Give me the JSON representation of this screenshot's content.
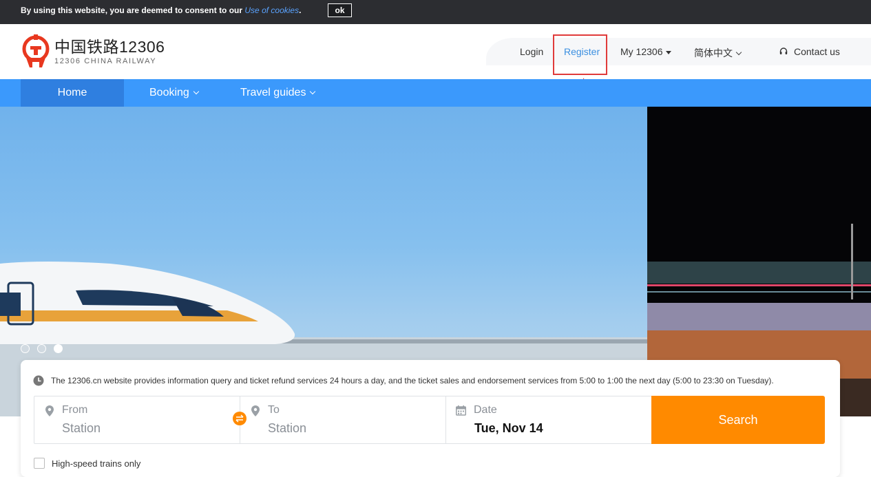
{
  "cookie": {
    "message": "By using this website, you are deemed to consent to our ",
    "link": "Use of cookies",
    "suffix": ".",
    "ok": "ok"
  },
  "logo": {
    "cn": "中国铁路12306",
    "en": "12306 CHINA RAILWAY"
  },
  "top_nav": {
    "login": "Login",
    "register": "Register",
    "my": "My 12306",
    "language": "简体中文",
    "contact": "Contact us"
  },
  "main_nav": {
    "home": "Home",
    "booking": "Booking",
    "guides": "Travel guides"
  },
  "carousel": {
    "slides": 3,
    "active": 3
  },
  "notice": "The 12306.cn website provides information query and ticket refund services 24 hours a day, and the ticket sales and endorsement services from 5:00 to 1:00 the next day (5:00 to 23:30 on Tuesday).",
  "search": {
    "from_label": "From",
    "from_value": "Station",
    "to_label": "To",
    "to_value": "Station",
    "date_label": "Date",
    "date_value": "Tue, Nov 14",
    "button": "Search",
    "high_speed": "High-speed trains only"
  },
  "colors": {
    "nav_blue": "#3b99fc",
    "nav_active": "#2f7fe0",
    "accent_orange": "#ff8a00",
    "logo_red": "#e8381f",
    "highlight_red": "#e03a3a"
  }
}
